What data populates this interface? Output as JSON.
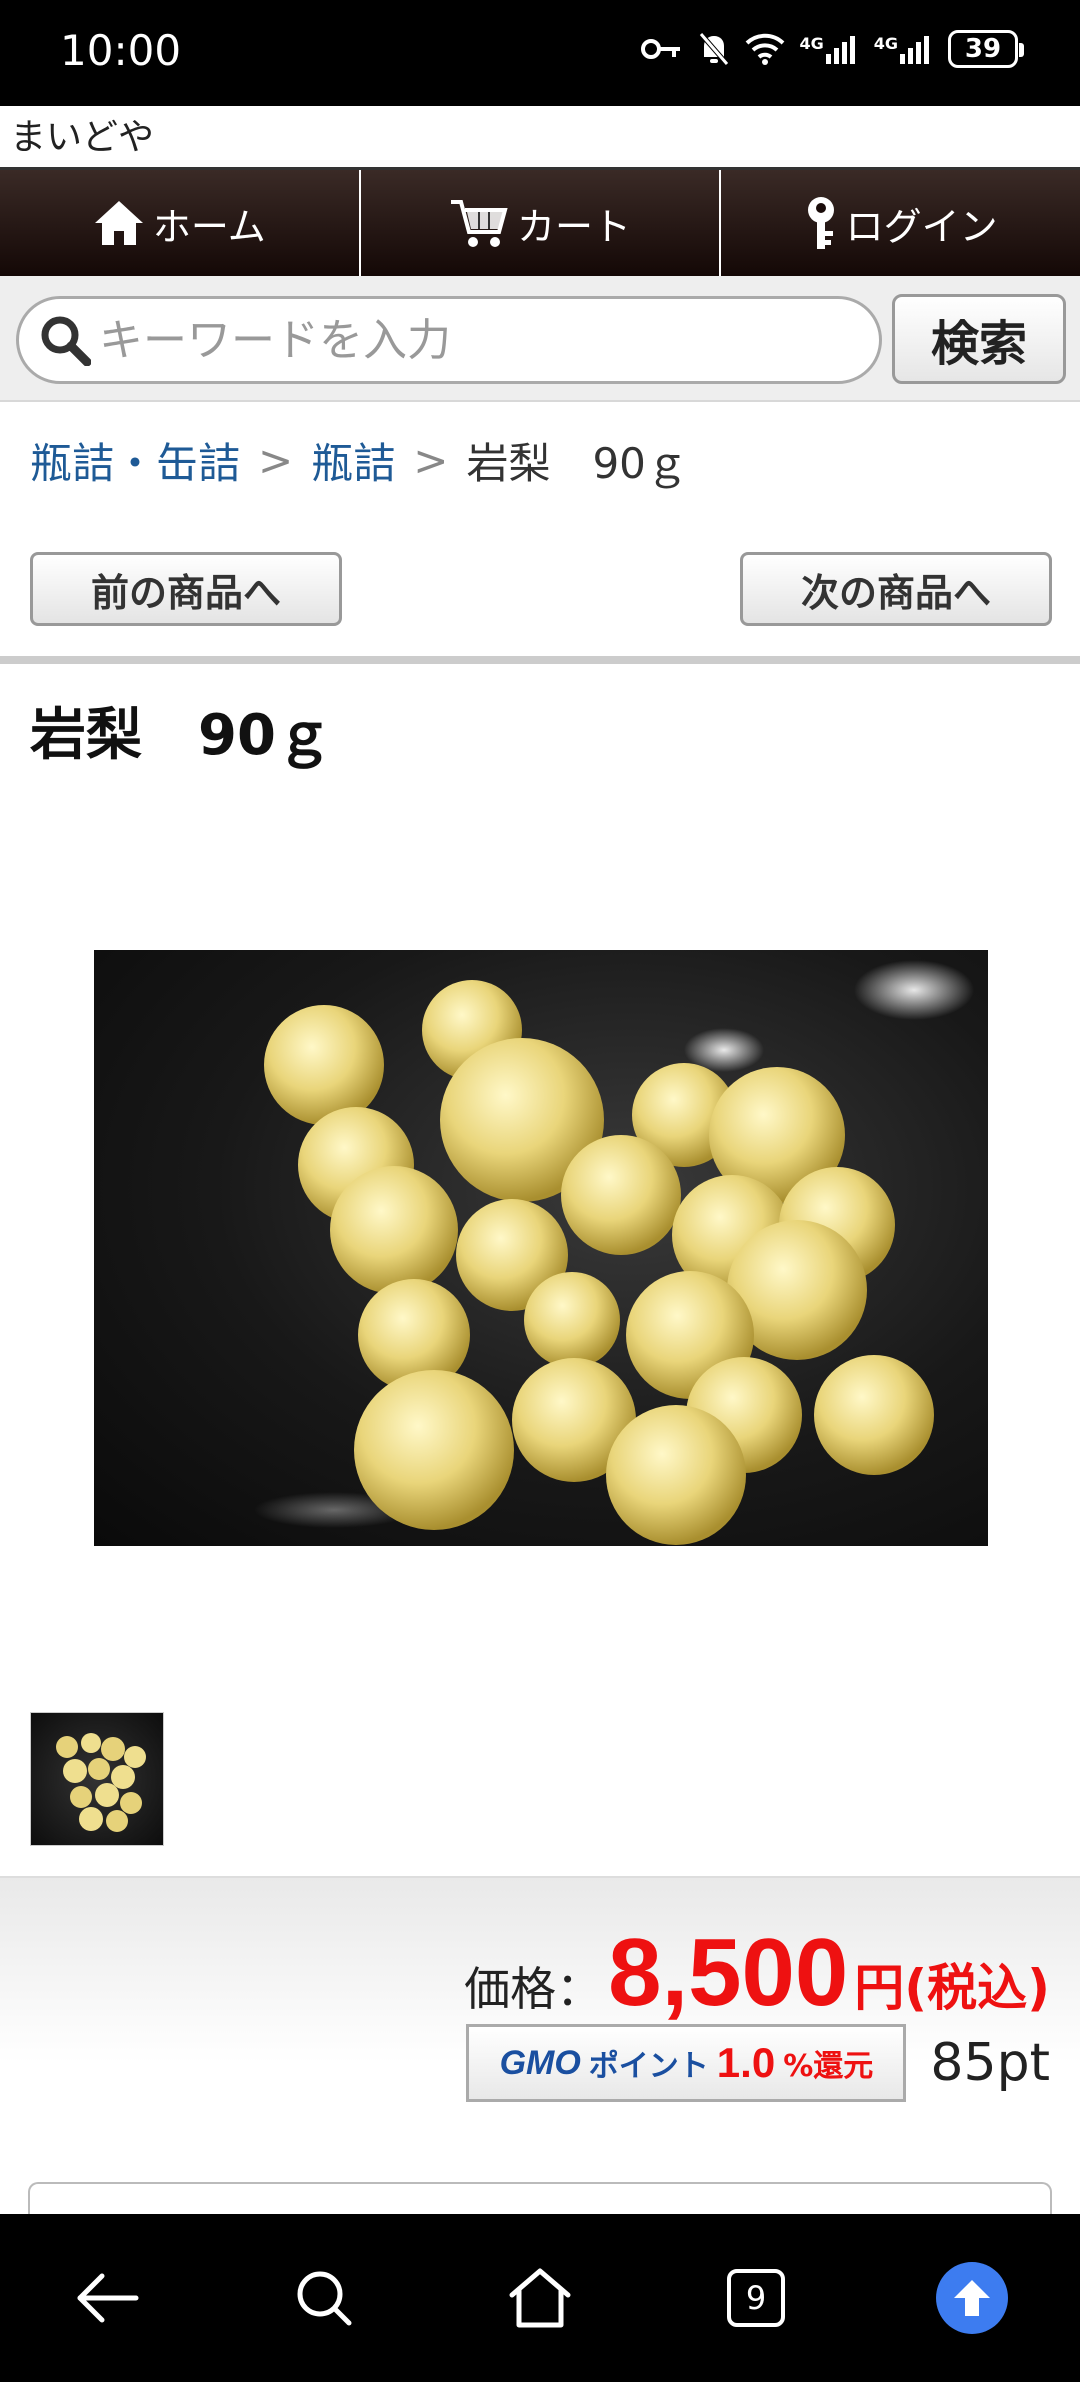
{
  "status_bar": {
    "time": "10:00",
    "battery": "39",
    "network_1": "4G",
    "network_2": "4G"
  },
  "site": {
    "title": "まいどや"
  },
  "nav": {
    "items": [
      {
        "label": "ホーム",
        "icon": "home-icon"
      },
      {
        "label": "カート",
        "icon": "cart-icon"
      },
      {
        "label": "ログイン",
        "icon": "key-icon"
      }
    ]
  },
  "search": {
    "placeholder": "キーワードを入力",
    "value": "",
    "button_label": "検索"
  },
  "breadcrumb": {
    "items": [
      "瓶詰・缶詰",
      "瓶詰"
    ],
    "separator": ">",
    "current": "岩梨　90ｇ"
  },
  "pager": {
    "prev_label": "前の商品へ",
    "next_label": "次の商品へ"
  },
  "product": {
    "title": "岩梨　90ｇ"
  },
  "price": {
    "label": "価格：",
    "value": "8,500",
    "unit": "円(税込)"
  },
  "gmo": {
    "brand": "GMO",
    "point_text": "ポイント",
    "rate": "1.0",
    "return_text": "%還元",
    "points": "85pt"
  },
  "bottom_nav": {
    "tab_count": "9"
  },
  "colors": {
    "price_red": "#ee1111",
    "link_blue": "#1e5a96",
    "nav_dark": "#1a0c0a",
    "upload_blue": "#3d7cf0"
  }
}
